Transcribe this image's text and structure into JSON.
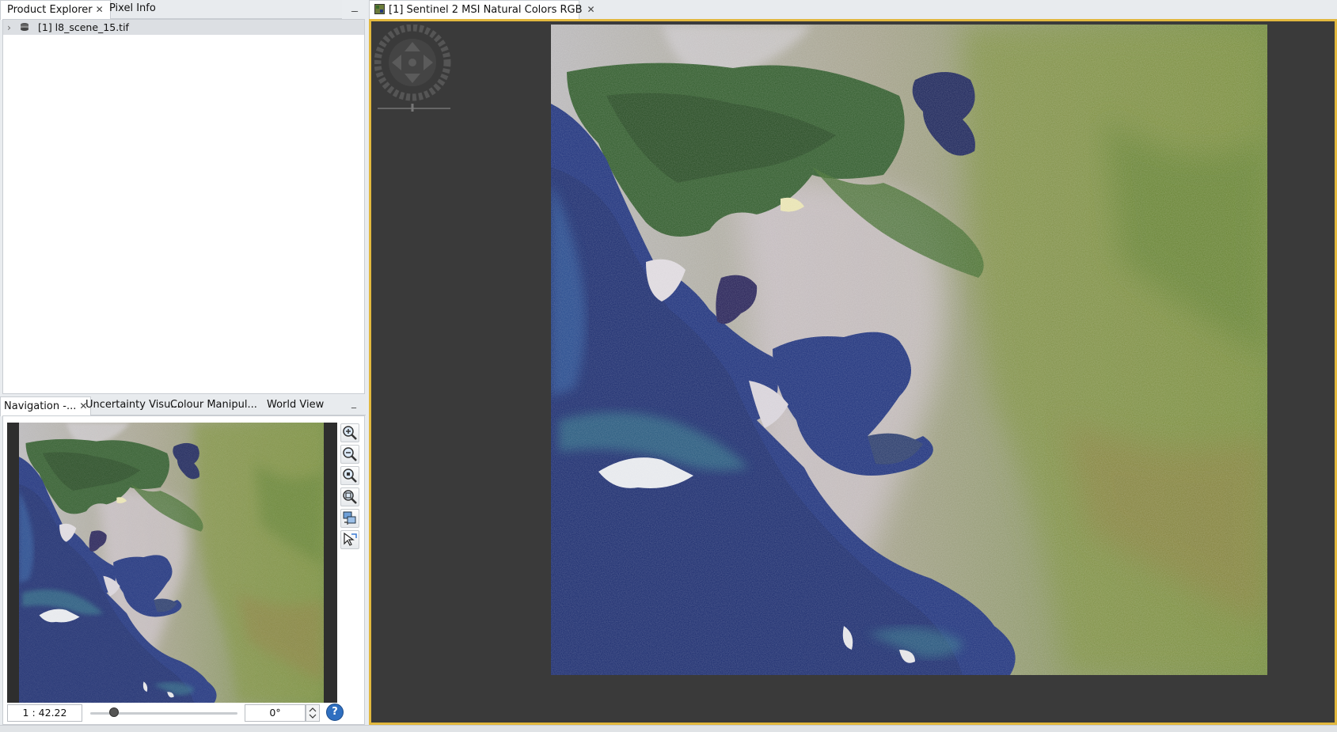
{
  "left_top": {
    "tabs": [
      {
        "label": "Product Explorer",
        "close": "✕"
      },
      {
        "label": "Pixel Info"
      }
    ],
    "minimize": "_",
    "tree": [
      {
        "expander": "›",
        "label": "[1] l8_scene_15.tif"
      }
    ]
  },
  "left_bottom": {
    "tabs": [
      {
        "label": "Navigation -...",
        "close": "✕"
      },
      {
        "label": "Uncertainty Visu..."
      },
      {
        "label": "Colour Manipul..."
      },
      {
        "label": "World View"
      }
    ],
    "minimize": "_",
    "zoom_buttons": [
      "zoom-in",
      "zoom-out",
      "zoom-actual",
      "zoom-all",
      "sync-views",
      "sync-cursor"
    ],
    "scale_value": "1 : 42.22",
    "zoom_slider_fraction": 0.14,
    "rotation_value": "0°",
    "help": "?"
  },
  "main_view": {
    "tab_label": "[1] Sentinel 2 MSI Natural Colors RGB",
    "tab_close": "✕"
  },
  "colors": {
    "accent_border": "#e2b83e",
    "canvas_bg": "#3a3a3a",
    "ocean": "#1b2f7a",
    "land": "#7f8a5a",
    "wetland": "#2f5a2c",
    "urban": "#c6bfc6"
  }
}
